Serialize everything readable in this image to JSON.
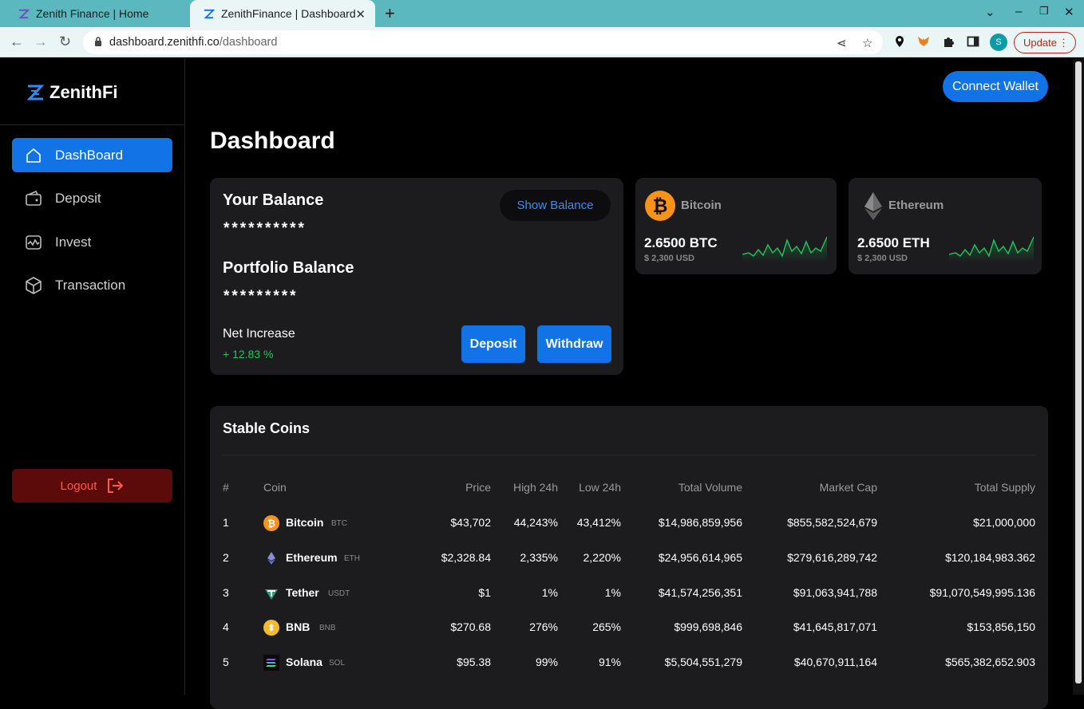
{
  "browser": {
    "tabs": [
      {
        "title": "Zenith Finance | Home",
        "active": false
      },
      {
        "title": "ZenithFinance | Dashboard",
        "active": true
      }
    ],
    "url_host": "dashboard.zenithfi.co",
    "url_path": "/dashboard",
    "profile_initial": "S",
    "update_label": "Update"
  },
  "brand": {
    "name": "ZenithFi"
  },
  "sidebar": {
    "items": [
      {
        "label": "DashBoard",
        "icon": "home-icon",
        "active": true
      },
      {
        "label": "Deposit",
        "icon": "wallet-icon",
        "active": false
      },
      {
        "label": "Invest",
        "icon": "chart-icon",
        "active": false
      },
      {
        "label": "Transaction",
        "icon": "cube-icon",
        "active": false
      }
    ],
    "logout_label": "Logout"
  },
  "header": {
    "connect_wallet": "Connect Wallet"
  },
  "page_title": "Dashboard",
  "balance": {
    "your_balance_label": "Your Balance",
    "your_balance_masked": "**********",
    "portfolio_label": "Portfolio Balance",
    "portfolio_masked": "*********",
    "show_balance_label": "Show Balance",
    "net_increase_label": "Net Increase",
    "net_increase_value": "+ 12.83 %",
    "deposit_label": "Deposit",
    "withdraw_label": "Withdraw"
  },
  "coin_cards": [
    {
      "name": "Bitcoin",
      "amount": "2.6500 BTC",
      "usd": "$ 2,300 USD",
      "icon": "bitcoin-icon"
    },
    {
      "name": "Ethereum",
      "amount": "2.6500 ETH",
      "usd": "$ 2,300 USD",
      "icon": "ethereum-icon"
    }
  ],
  "stable_coins": {
    "title": "Stable Coins",
    "columns": [
      "#",
      "Coin",
      "Price",
      "High 24h",
      "Low 24h",
      "Total Volume",
      "Market Cap",
      "Total Supply"
    ],
    "rows": [
      {
        "rank": "1",
        "name": "Bitcoin",
        "symbol": "BTC",
        "price": "$43,702",
        "high": "44,243%",
        "low": "43,412%",
        "volume": "$14,986,859,956",
        "mcap": "$855,582,524,679",
        "supply": "$21,000,000"
      },
      {
        "rank": "2",
        "name": "Ethereum",
        "symbol": "ETH",
        "price": "$2,328.84",
        "high": "2,335%",
        "low": "2,220%",
        "volume": "$24,956,614,965",
        "mcap": "$279,616,289,742",
        "supply": "$120,184,983.362"
      },
      {
        "rank": "3",
        "name": "Tether",
        "symbol": "USDT",
        "price": "$1",
        "high": "1%",
        "low": "1%",
        "volume": "$41,574,256,351",
        "mcap": "$91,063,941,788",
        "supply": "$91,070,549,995.136"
      },
      {
        "rank": "4",
        "name": "BNB",
        "symbol": "BNB",
        "price": "$270.68",
        "high": "276%",
        "low": "265%",
        "volume": "$999,698,846",
        "mcap": "$41,645,817,071",
        "supply": "$153,856,150"
      },
      {
        "rank": "5",
        "name": "Solana",
        "symbol": "SOL",
        "price": "$95.38",
        "high": "99%",
        "low": "91%",
        "volume": "$5,504,551,279",
        "mcap": "$40,670,911,164",
        "supply": "$565,382,652.903"
      }
    ]
  },
  "colors": {
    "accent": "#1273e6",
    "positive": "#22c55e",
    "danger": "#ff5a4f",
    "card": "#1c1c1e"
  }
}
